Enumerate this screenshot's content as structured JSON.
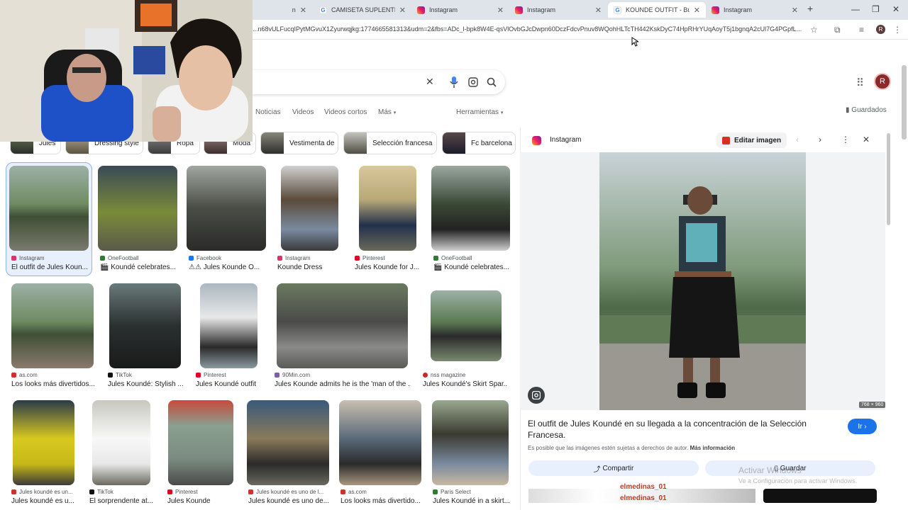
{
  "tabs": [
    {
      "title": "n",
      "icon": "generic"
    },
    {
      "title": "CAMISETA SUPLENTE DE",
      "icon": "google"
    },
    {
      "title": "Instagram",
      "icon": "instagram"
    },
    {
      "title": "Instagram",
      "icon": "instagram"
    },
    {
      "title": "KOUNDE OUTFIT - Buscar",
      "icon": "google",
      "active": true
    },
    {
      "title": "Instagram",
      "icon": "instagram"
    }
  ],
  "address_bar": {
    "url": "...n68vULFucqIPytMGvuX1Zyurwqjkg:1774665581313&udm=2&fbs=ADc_l-bpk8W4E-qsVlOvbGJcDwpn60DczFdcvPnuv8WQohHLTcTH442KskDyC74HpRHrYUqAoyT5j1bgnqA2cUl7G4PGpfL...",
    "profile_initial": "R"
  },
  "google": {
    "profile_initial": "R",
    "saved_label": "Guardados",
    "nav_tabs": [
      "Noticias",
      "Videos",
      "Videos cortos",
      "Más",
      "Herramientas"
    ]
  },
  "chips": [
    {
      "label": "Jules"
    },
    {
      "label": "Dressing style"
    },
    {
      "label": "Ropa"
    },
    {
      "label": "Moda"
    },
    {
      "label": "Vestimenta de"
    },
    {
      "label": "Selección francesa"
    },
    {
      "label": "Fc barcelona"
    }
  ],
  "results": [
    {
      "source": "Instagram",
      "title": "El outfit de Jules Koun...",
      "src_color": "#e1306c"
    },
    {
      "source": "OneFootball",
      "title": "🎬 Koundé celebrates...",
      "src_color": "#2e7d32"
    },
    {
      "source": "Facebook",
      "title": "⚠⚠ Jules Kounde O...",
      "src_color": "#1877f2"
    },
    {
      "source": "Instagram",
      "title": "Kounde Dress",
      "src_color": "#e1306c"
    },
    {
      "source": "Pinterest",
      "title": "Jules Kounde for J...",
      "src_color": "#e60023"
    },
    {
      "source": "OneFootball",
      "title": "🎬 Koundé celebrates...",
      "src_color": "#2e7d32"
    },
    {
      "source": "as.com",
      "title": "Los looks más divertidos...",
      "src_color": "#d32f2f"
    },
    {
      "source": "TikTok",
      "title": "Jules Koundé: Stylish ...",
      "src_color": "#111111"
    },
    {
      "source": "Pinterest",
      "title": "Jules Koundé outfit",
      "src_color": "#e60023"
    },
    {
      "source": "90Min.com",
      "title": "Jules Kounde admits he is the 'man of the ...",
      "src_color": "#7b5ea7"
    },
    {
      "source": "nss magazine",
      "title": "Jules Koundé's Skirt Spar...",
      "src_color": "#c62828"
    },
    {
      "source": "Jules koundé es un...",
      "title": "Jules koundé es u...",
      "src_color": "#d32f2f"
    },
    {
      "source": "TikTok",
      "title": "El sorprendente at...",
      "src_color": "#111111"
    },
    {
      "source": "Pinterest",
      "title": "Jules Kounde",
      "src_color": "#e60023"
    },
    {
      "source": "Jules koundé es uno de l...",
      "title": "Jules koundé es uno de...",
      "src_color": "#d32f2f"
    },
    {
      "source": "as.com",
      "title": "Los looks más divertido...",
      "src_color": "#d32f2f"
    },
    {
      "source": "Paris Select",
      "title": "Jules Koundé in a skirt...",
      "src_color": "#2e7d32"
    }
  ],
  "panel": {
    "source": "Instagram",
    "edit_label": "Editar imagen",
    "dimensions": "768 × 960",
    "title": "El outfit de Jules Koundé en su llegada a la concentración de la Selección Francesa.",
    "go_label": "Ir",
    "copyright": "Es posible que las imágenes estén sujetas a derechos de autor.",
    "more_info": "Más información",
    "share_label": "Compartir",
    "save_label": "Guardar",
    "related_user": "elmedinas_01"
  },
  "windows_watermark": {
    "line1": "Activar Windows",
    "line2": "Ve a Configuración para activar Windows."
  }
}
